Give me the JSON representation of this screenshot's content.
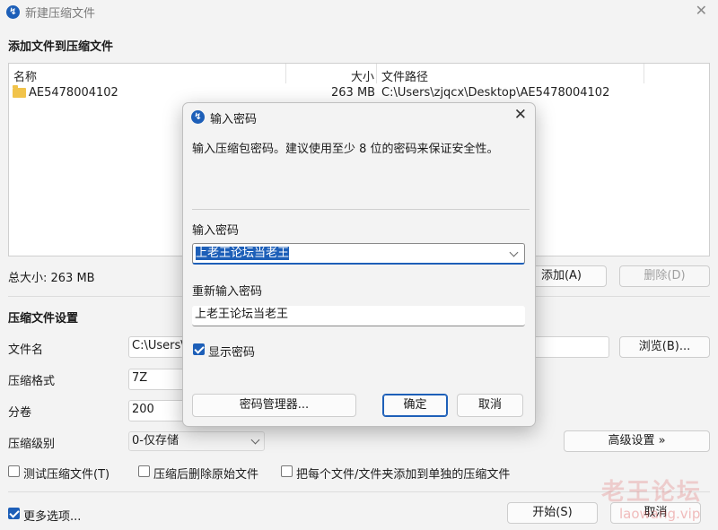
{
  "window": {
    "title": "新建压缩文件",
    "close": "✕"
  },
  "add_section": {
    "title": "添加文件到压缩文件"
  },
  "file_list": {
    "headers": {
      "name": "名称",
      "size": "大小",
      "path": "文件路径"
    },
    "rows": [
      {
        "name": "AE5478004102",
        "size": "263 MB",
        "path": "C:\\Users\\zjqcx\\Desktop\\AE5478004102"
      }
    ]
  },
  "total_size": "总大小: 263 MB",
  "buttons": {
    "add": "添加(A)",
    "delete": "删除(D)",
    "browse": "浏览(B)...",
    "advanced": "高级设置 »",
    "start": "开始(S)",
    "cancel": "取消"
  },
  "settings": {
    "title": "压缩文件设置",
    "filename_label": "文件名",
    "filename_value": "C:\\Users\\",
    "format_label": "压缩格式",
    "format_value": "7Z",
    "volume_label": "分卷",
    "volume_value": "200",
    "level_label": "压缩级别",
    "level_value": "0-仅存储"
  },
  "options": {
    "test": "测试压缩文件(T)",
    "delete_after": "压缩后删除原始文件",
    "each_separate": "把每个文件/文件夹添加到单独的压缩文件",
    "more": "更多选项..."
  },
  "watermark": {
    "big": "老王论坛",
    "small": "laowang.vip"
  },
  "dialog": {
    "title": "输入密码",
    "close": "✕",
    "description": "输入压缩包密码。建议使用至少 8 位的密码来保证安全性。",
    "password_label": "输入密码",
    "password_value": "上老王论坛当老王",
    "reenter_label": "重新输入密码",
    "reenter_value": "上老王论坛当老王",
    "show_password": "显示密码",
    "manager_button": "密码管理器...",
    "ok_button": "确定",
    "cancel_button": "取消"
  },
  "colors": {
    "accent": "#1d5fb8",
    "background": "#f3f3f3"
  }
}
